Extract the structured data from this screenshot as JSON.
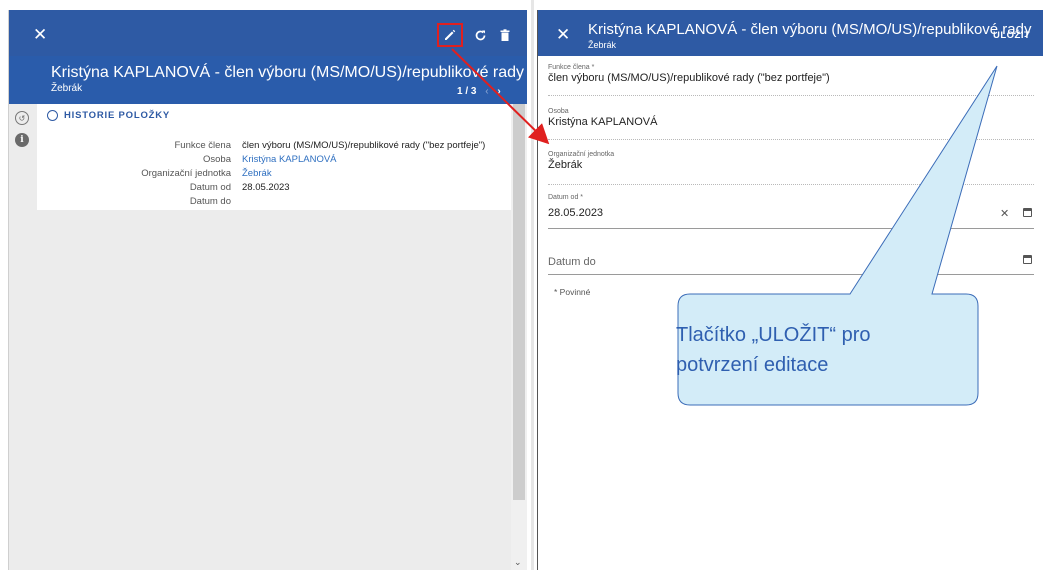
{
  "left_panel": {
    "close_icon": "close-icon",
    "toolbar_icons": [
      "edit-icon",
      "refresh-icon",
      "delete-icon"
    ],
    "title": "Kristýna KAPLANOVÁ - člen výboru (MS/MO/US)/republikové rady (\"…",
    "subtitle": "Žebrák",
    "pager": {
      "position": "1 / 3",
      "prev": "‹",
      "next": "›"
    },
    "rail_icons": [
      "history-icon",
      "info-icon"
    ],
    "section_title": "HISTORIE POLOŽKY",
    "details": [
      {
        "label": "Funkce člena",
        "value": "člen výboru (MS/MO/US)/republikové rady (\"bez portfeje\")",
        "link": false
      },
      {
        "label": "Osoba",
        "value": "Kristýna KAPLANOVÁ",
        "link": true
      },
      {
        "label": "Organizační jednotka",
        "value": "Žebrák",
        "link": true
      },
      {
        "label": "Datum od",
        "value": "28.05.2023",
        "link": false
      },
      {
        "label": "Datum do",
        "value": "",
        "link": false
      }
    ]
  },
  "right_panel": {
    "close_icon": "close-icon",
    "title": "Kristýna KAPLANOVÁ - člen výboru (MS/MO/US)/republikové rady",
    "subtitle": "Žebrák",
    "save_label": "ULOŽIT",
    "fields": {
      "funkce": {
        "label": "Funkce člena *",
        "value": "člen výboru (MS/MO/US)/republikové rady (\"bez portfeje\")"
      },
      "osoba": {
        "label": "Osoba",
        "value": "Kristýna KAPLANOVÁ"
      },
      "jednotka": {
        "label": "Organizační jednotka",
        "value": "Žebrák"
      },
      "datum_od": {
        "label": "Datum od *",
        "value": "28.05.2023"
      },
      "datum_do": {
        "placeholder": "Datum do"
      }
    },
    "required_note": "* Povinné"
  },
  "annotation": {
    "callout_line1": "Tlačítko „ULOŽIT“ pro",
    "callout_line2": "potvrzení editace",
    "highlight_color": "#e0201f",
    "callout_fill": "#d3ecf8",
    "callout_border": "#3b6cb8"
  },
  "colors": {
    "header_blue": "#2e5aa4",
    "link_blue": "#2e6fc0"
  }
}
